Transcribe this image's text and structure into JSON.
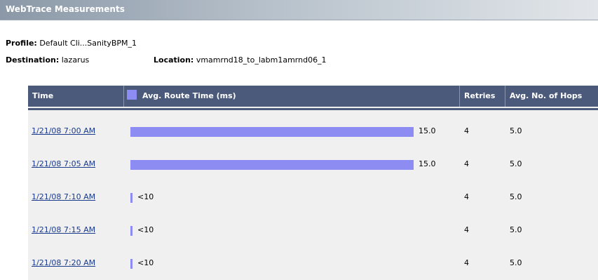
{
  "header": {
    "title": "WebTrace Measurements"
  },
  "info": {
    "profile_label": "Profile:",
    "profile_value": "Default Cli...SanityBPM_1",
    "destination_label": "Destination:",
    "destination_value": "lazarus",
    "location_label": "Location:",
    "location_value": "vmamrnd18_to_labm1amrnd06_1"
  },
  "table": {
    "columns": [
      "Time",
      "Avg. Route Time (ms)",
      "Retries",
      "Avg. No. of Hops"
    ],
    "legend_color": "#8c8cf2",
    "rows": [
      {
        "time": "1/21/08 7:00 AM",
        "avg_route_label": "15.0",
        "avg_route_fraction": 1.0,
        "retries": "4",
        "hops": "5.0"
      },
      {
        "time": "1/21/08 7:05 AM",
        "avg_route_label": "15.0",
        "avg_route_fraction": 1.0,
        "retries": "4",
        "hops": "5.0"
      },
      {
        "time": "1/21/08 7:10 AM",
        "avg_route_label": "<10",
        "avg_route_fraction": 0.0,
        "retries": "4",
        "hops": "5.0"
      },
      {
        "time": "1/21/08 7:15 AM",
        "avg_route_label": "<10",
        "avg_route_fraction": 0.0,
        "retries": "4",
        "hops": "5.0"
      },
      {
        "time": "1/21/08 7:20 AM",
        "avg_route_label": "<10",
        "avg_route_fraction": 0.0,
        "retries": "4",
        "hops": "5.0"
      }
    ]
  }
}
